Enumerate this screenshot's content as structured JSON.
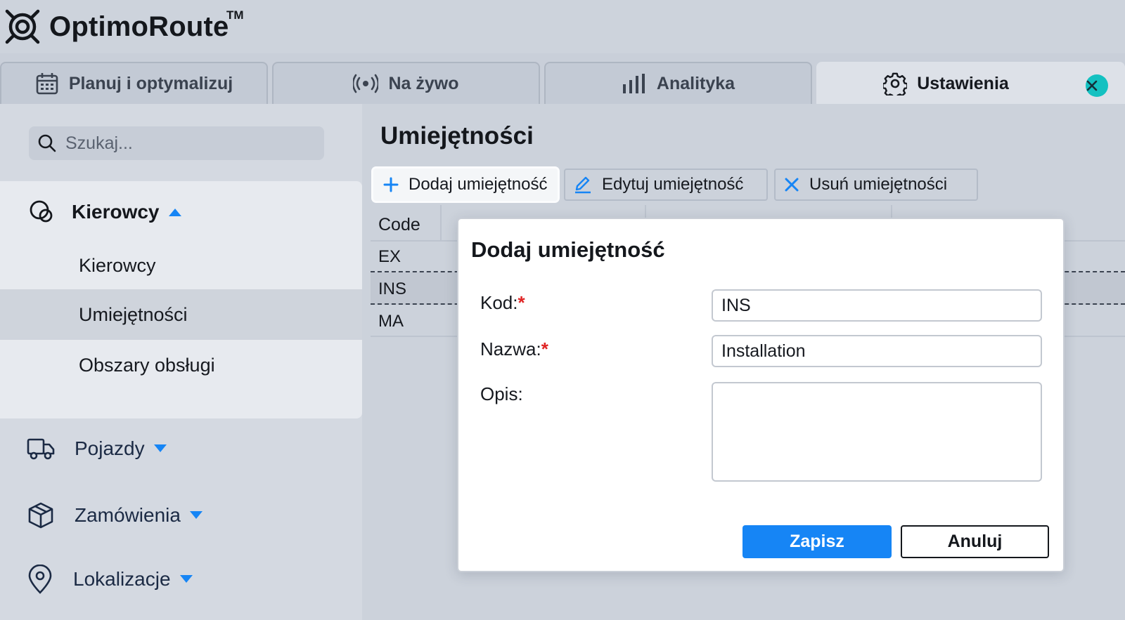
{
  "app": {
    "name": "OptimoRoute",
    "trademark": "TM"
  },
  "tabs": [
    {
      "label": "Planuj i optymalizuj",
      "icon": "calendar-icon"
    },
    {
      "label": "Na żywo",
      "icon": "live-broadcast-icon"
    },
    {
      "label": "Analityka",
      "icon": "bar-chart-icon"
    },
    {
      "label": "Ustawienia",
      "icon": "gear-icon",
      "active": true
    }
  ],
  "sidebar": {
    "search_placeholder": "Szukaj...",
    "groups": [
      {
        "label": "Kierowcy",
        "icon": "drivers-icon",
        "expanded": true,
        "items": [
          {
            "label": "Kierowcy"
          },
          {
            "label": "Umiejętności",
            "selected": true
          },
          {
            "label": "Obszary obsługi"
          }
        ]
      },
      {
        "label": "Pojazdy",
        "icon": "truck-icon"
      },
      {
        "label": "Zamówienia",
        "icon": "box-icon"
      },
      {
        "label": "Lokalizacje",
        "icon": "location-pin-icon"
      }
    ]
  },
  "main": {
    "title": "Umiejętności",
    "toolbar": {
      "add_label": "Dodaj umiejętność",
      "edit_label": "Edytuj umiejętność",
      "delete_label": "Usuń umiejętności"
    },
    "table": {
      "columns": [
        "Code"
      ],
      "rows": [
        {
          "code": "EX"
        },
        {
          "code": "INS",
          "selected": true
        },
        {
          "code": "MA"
        }
      ]
    }
  },
  "dialog": {
    "title": "Dodaj umiejętność",
    "fields": {
      "code_label": "Kod:",
      "code_value": "INS",
      "name_label": "Nazwa:",
      "name_value": "Installation",
      "description_label": "Opis:",
      "description_value": ""
    },
    "required_marker": "*",
    "save_label": "Zapisz",
    "cancel_label": "Anuluj"
  },
  "colors": {
    "accent": "#1685f5",
    "required": "#e02424",
    "close_button": "#14c1c1",
    "sidebar_active_group": "#e7eaef"
  }
}
